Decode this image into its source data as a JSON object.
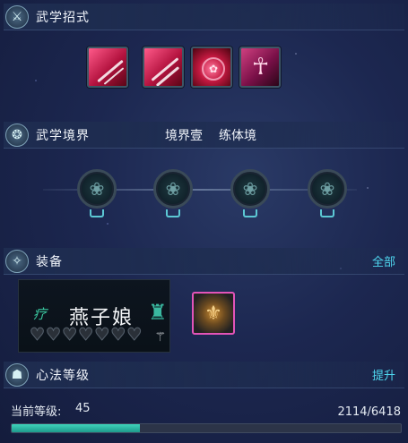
{
  "sections": {
    "skills": {
      "title": "武学招式",
      "icon": "sword-icon"
    },
    "realm": {
      "title": "武学境界",
      "realm_name": "境界壹",
      "stage_name": "练体境",
      "icon": "swirl-icon"
    },
    "equipment": {
      "title": "装备",
      "all_label": "全部",
      "icon": "gear-icon"
    },
    "mind": {
      "title": "心法等级",
      "upgrade_label": "提升",
      "icon": "figure-icon"
    }
  },
  "skills": [
    "slash-skill-icon",
    "double-slash-skill-icon",
    "rose-skill-icon",
    "dancer-skill-icon"
  ],
  "realm_nodes": [
    "locked-node",
    "locked-node",
    "locked-node",
    "locked-node"
  ],
  "equip_card": {
    "symbol": "疗",
    "name": "燕子娘",
    "hearts_total": 7,
    "hearts_filled": 0,
    "trigram": "⚚"
  },
  "level": {
    "label": "当前等级:",
    "value": "45",
    "progress_text": "2114/6418",
    "current": 2114,
    "max": 6418
  },
  "colors": {
    "accent": "#4fd8f0",
    "progress": "#2fbfa8",
    "equip_border": "#e254b8"
  }
}
